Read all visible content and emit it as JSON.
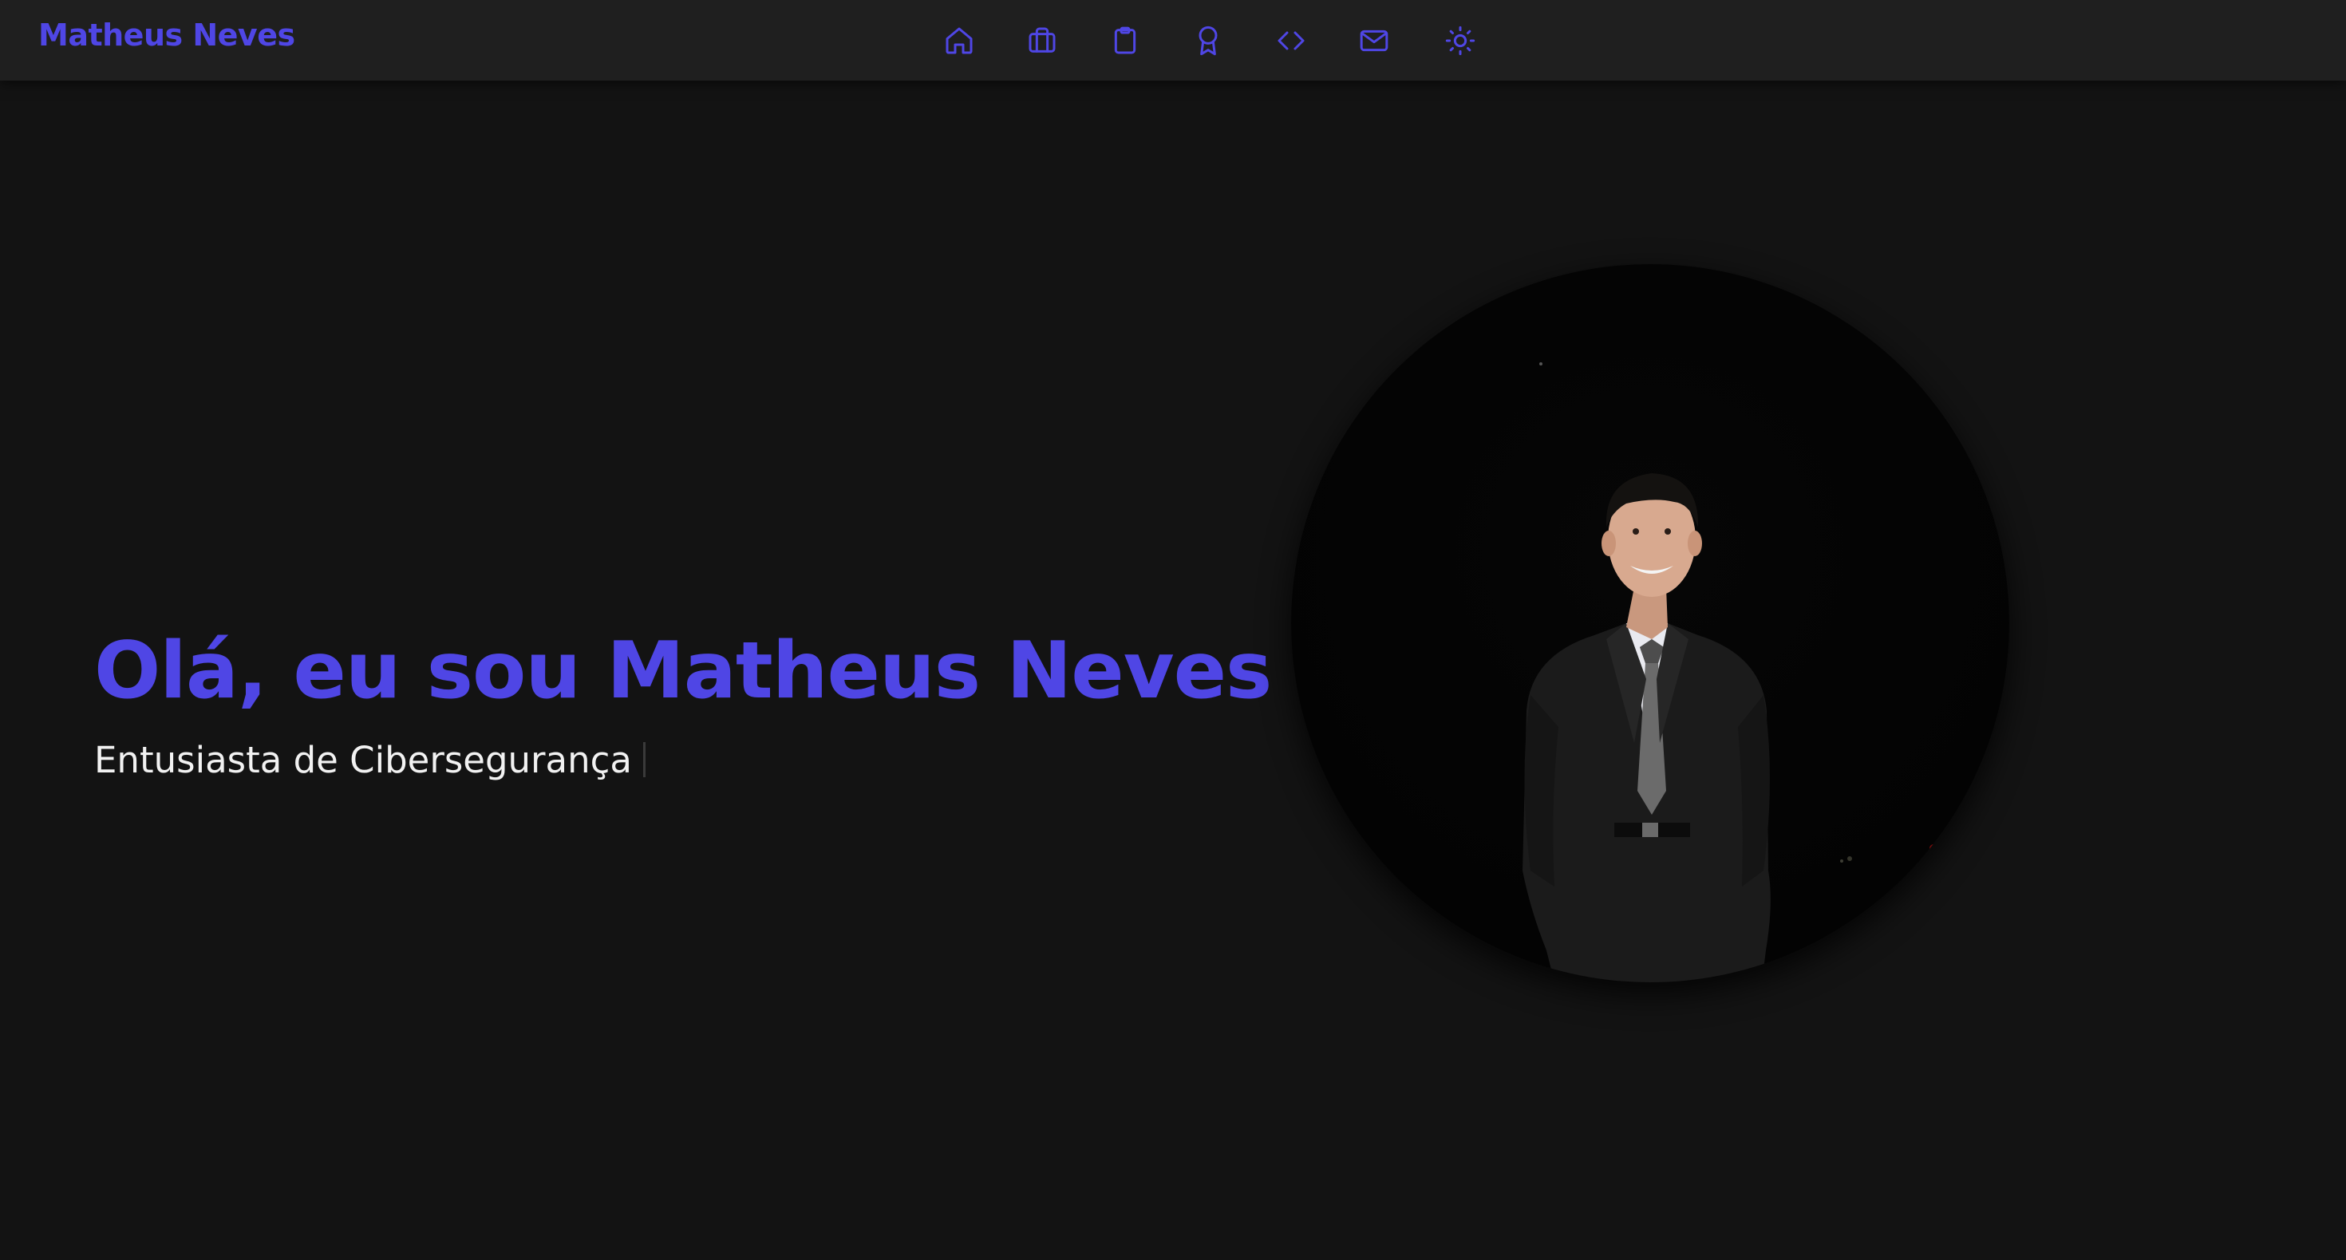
{
  "nav": {
    "brand": "Matheus Neves",
    "items": [
      {
        "name": "home",
        "icon": "home-icon"
      },
      {
        "name": "experience",
        "icon": "briefcase-icon"
      },
      {
        "name": "projects",
        "icon": "clipboard-icon"
      },
      {
        "name": "certifications",
        "icon": "award-icon"
      },
      {
        "name": "skills",
        "icon": "code-icon"
      },
      {
        "name": "contact",
        "icon": "mail-icon"
      },
      {
        "name": "theme-toggle",
        "icon": "sun-icon"
      }
    ]
  },
  "hero": {
    "title": "Olá, eu sou Matheus Neves",
    "subtitle": "Entusiasta de Cibersegurança"
  },
  "colors": {
    "accent": "#4f46e5",
    "background": "#131313",
    "navbar": "#1f1f1f",
    "text": "#f2f2f2"
  }
}
